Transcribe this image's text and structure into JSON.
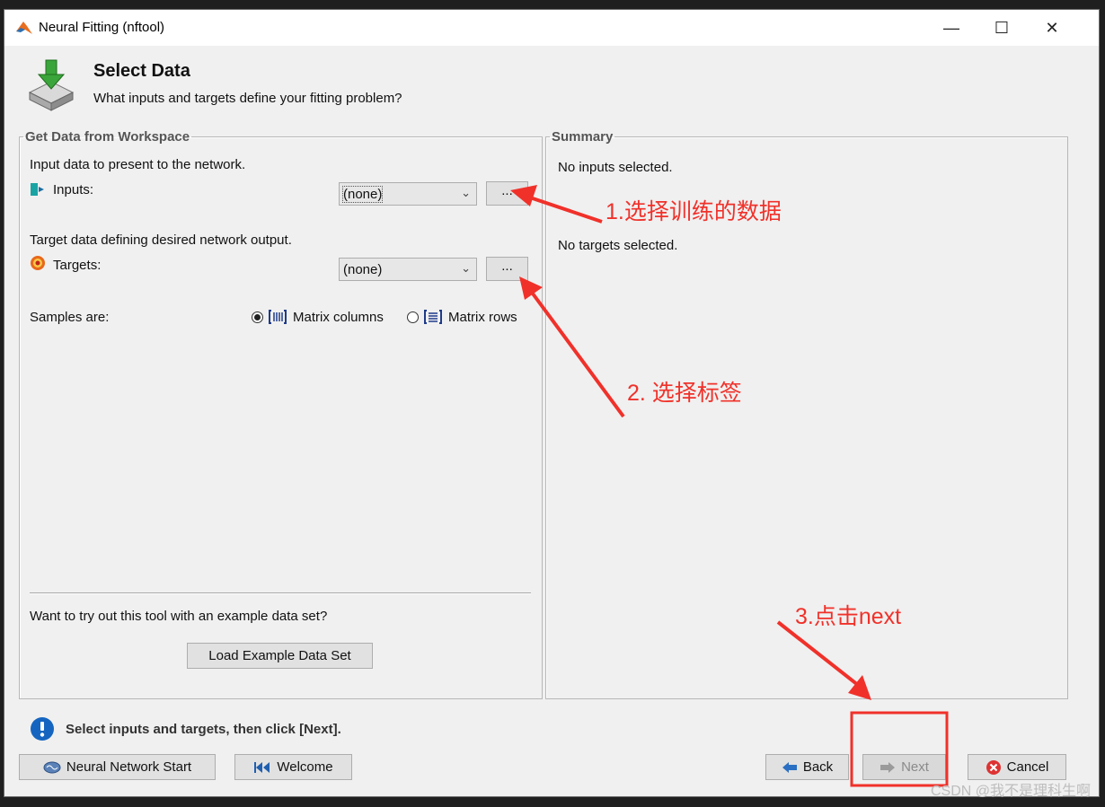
{
  "window": {
    "title": "Neural Fitting (nftool)"
  },
  "header": {
    "title": "Select Data",
    "subtitle": "What inputs and targets define your fitting problem?"
  },
  "workspace": {
    "legend": "Get Data from Workspace",
    "input_prompt": "Input data to present to the network.",
    "inputs_label": "Inputs:",
    "inputs_value": "(none)",
    "target_prompt": "Target data defining desired network output.",
    "targets_label": "Targets:",
    "targets_value": "(none)",
    "browse_label": "...",
    "samples_label": "Samples are:",
    "matrix_columns": "Matrix columns",
    "matrix_rows": "Matrix rows",
    "example_prompt": "Want to try out this tool with an example data set?",
    "load_example": "Load Example Data Set"
  },
  "summary": {
    "legend": "Summary",
    "inputs_status": "No inputs selected.",
    "targets_status": "No targets selected."
  },
  "status": {
    "message": "Select inputs and targets, then click [Next]."
  },
  "footer": {
    "nn_start": "Neural Network Start",
    "welcome": "Welcome",
    "back": "Back",
    "next": "Next",
    "cancel": "Cancel"
  },
  "annotations": {
    "step1": "1.选择训练的数据",
    "step2": "2. 选择标签",
    "step3": "3.点击next"
  },
  "watermark": "CSDN @我不是理科生啊",
  "colors": {
    "annotation": "#f0312a",
    "info": "#1565c0"
  }
}
